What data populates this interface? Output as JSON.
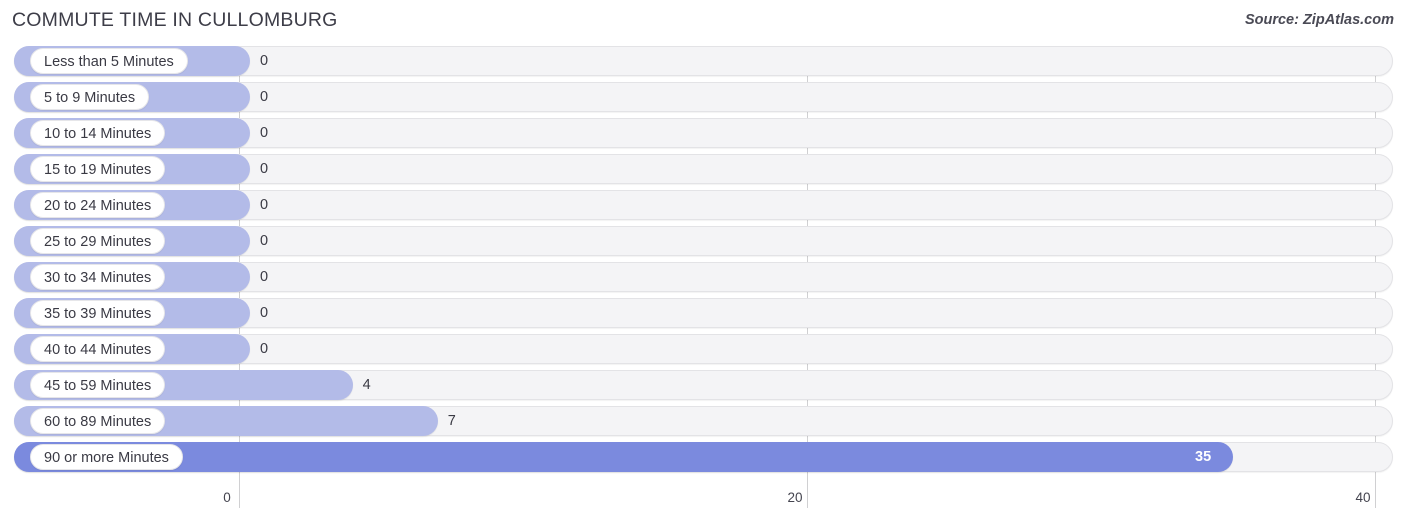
{
  "header": {
    "title": "COMMUTE TIME IN CULLOMBURG",
    "source": "Source: ZipAtlas.com"
  },
  "colors": {
    "bar": "#b3bbe8",
    "bar_highlight": "#7b8ade",
    "track": "#f4f4f6",
    "gridline": "#d0d0d2",
    "text": "#3a3a44"
  },
  "chart_data": {
    "type": "bar",
    "orientation": "horizontal",
    "title": "COMMUTE TIME IN CULLOMBURG",
    "xlabel": "",
    "ylabel": "",
    "xlim": [
      0,
      40
    ],
    "grid": true,
    "legend": "none",
    "ticks": [
      "0",
      "20",
      "40"
    ],
    "tick_values": [
      0,
      20,
      40
    ],
    "categories": [
      "Less than 5 Minutes",
      "5 to 9 Minutes",
      "10 to 14 Minutes",
      "15 to 19 Minutes",
      "20 to 24 Minutes",
      "25 to 29 Minutes",
      "30 to 34 Minutes",
      "35 to 39 Minutes",
      "40 to 44 Minutes",
      "45 to 59 Minutes",
      "60 to 89 Minutes",
      "90 or more Minutes"
    ],
    "values": [
      0,
      0,
      0,
      0,
      0,
      0,
      0,
      0,
      0,
      4,
      7,
      35
    ],
    "value_labels": [
      "0",
      "0",
      "0",
      "0",
      "0",
      "0",
      "0",
      "0",
      "0",
      "4",
      "7",
      "35"
    ],
    "highlight_index": 11
  }
}
